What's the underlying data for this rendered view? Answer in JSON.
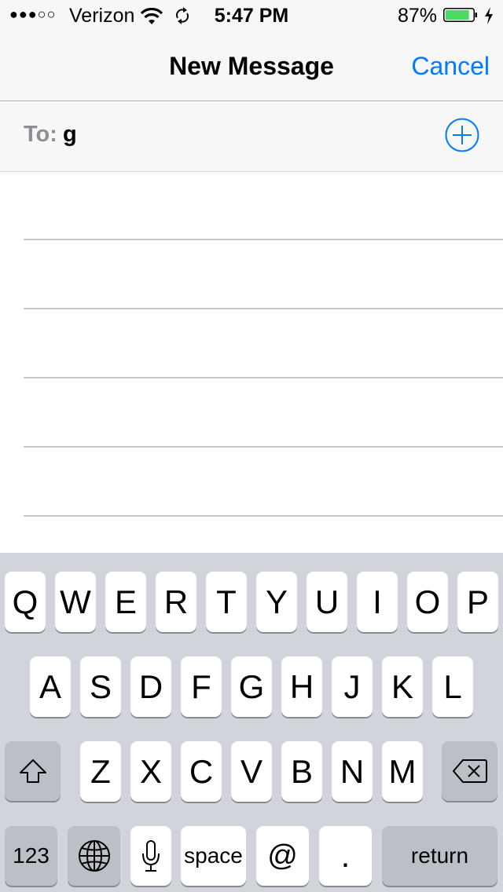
{
  "status_bar": {
    "signal": "●●●○○",
    "carrier": "Verizon",
    "time": "5:47 PM",
    "battery_percent": "87%",
    "battery_level": 0.87,
    "icons": [
      "signal-dots-icon",
      "wifi-icon",
      "sync-icon",
      "battery-icon",
      "charging-bolt-icon"
    ]
  },
  "nav": {
    "title": "New Message",
    "cancel_label": "Cancel"
  },
  "to_field": {
    "label": "To:",
    "value": "g",
    "add_icon": "add-contact-plus-icon"
  },
  "suggestions": [],
  "colors": {
    "accent": "#007aff",
    "label_gray": "#8e8e93",
    "battery_green": "#4cd964",
    "keyboard_bg": "#d1d5db"
  },
  "keyboard": {
    "row1": [
      "Q",
      "W",
      "E",
      "R",
      "T",
      "Y",
      "U",
      "I",
      "O",
      "P"
    ],
    "row2": [
      "A",
      "S",
      "D",
      "F",
      "G",
      "H",
      "J",
      "K",
      "L"
    ],
    "row3": [
      "Z",
      "X",
      "C",
      "V",
      "B",
      "N",
      "M"
    ],
    "shift_icon": "shift-arrow-icon",
    "delete_icon": "backspace-icon",
    "numbers_label": "123",
    "globe_icon": "globe-icon",
    "mic_icon": "microphone-icon",
    "space_label": "space",
    "at_label": "@",
    "dot_label": ".",
    "return_label": "return"
  }
}
